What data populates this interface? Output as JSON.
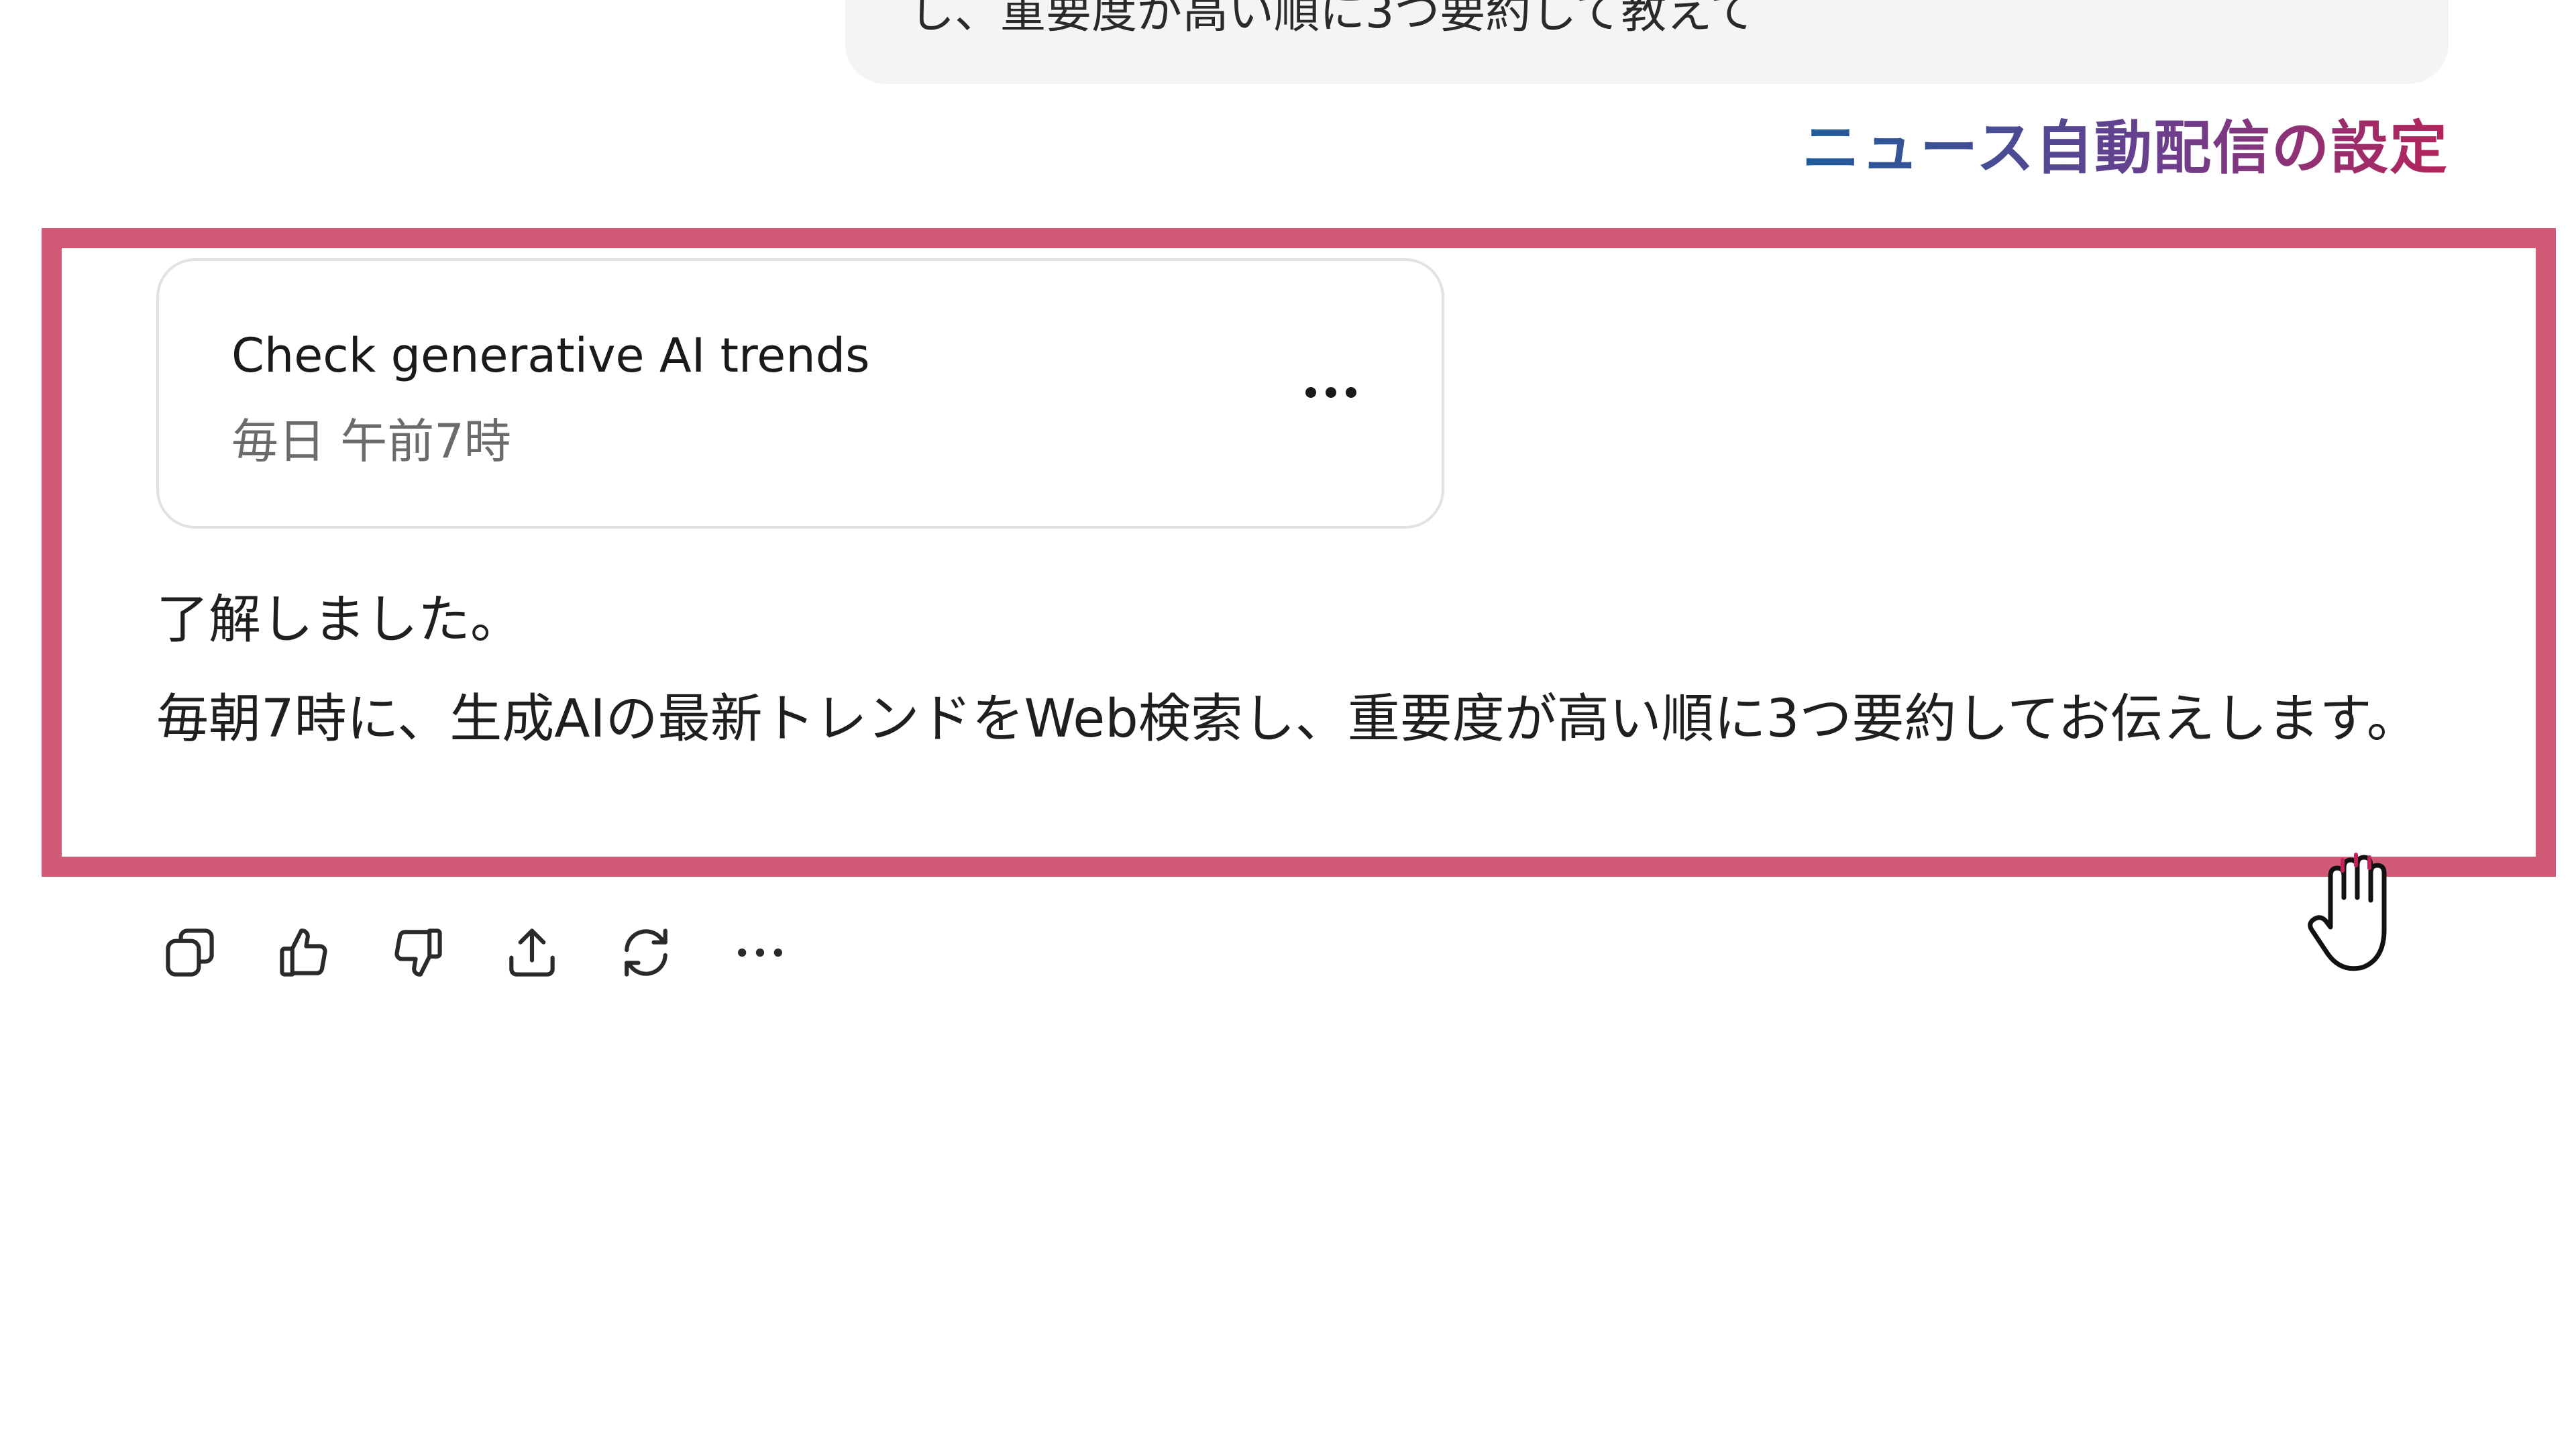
{
  "user_message": {
    "visible_text": "し、重要度が高い順に3つ要約して教えて"
  },
  "annotation": {
    "caption": "ニュース自動配信の設定"
  },
  "task_card": {
    "title": "Check generative AI trends",
    "schedule": "毎日 午前7時",
    "more_icon": "ellipsis-icon"
  },
  "assistant_message": {
    "line1": "了解しました。",
    "line2": "毎朝7時に、生成AIの最新トレンドをWeb検索し、重要度が高い順に3つ要約してお伝えします。"
  },
  "actions": [
    {
      "icon": "copy-icon"
    },
    {
      "icon": "thumbs-up-icon"
    },
    {
      "icon": "thumbs-down-icon"
    },
    {
      "icon": "share-icon"
    },
    {
      "icon": "regenerate-icon"
    },
    {
      "icon": "more-icon"
    }
  ],
  "colors": {
    "highlight": "#d05a78",
    "caption_gradient_start": "#1f5c9a",
    "caption_gradient_end": "#b5235a"
  }
}
